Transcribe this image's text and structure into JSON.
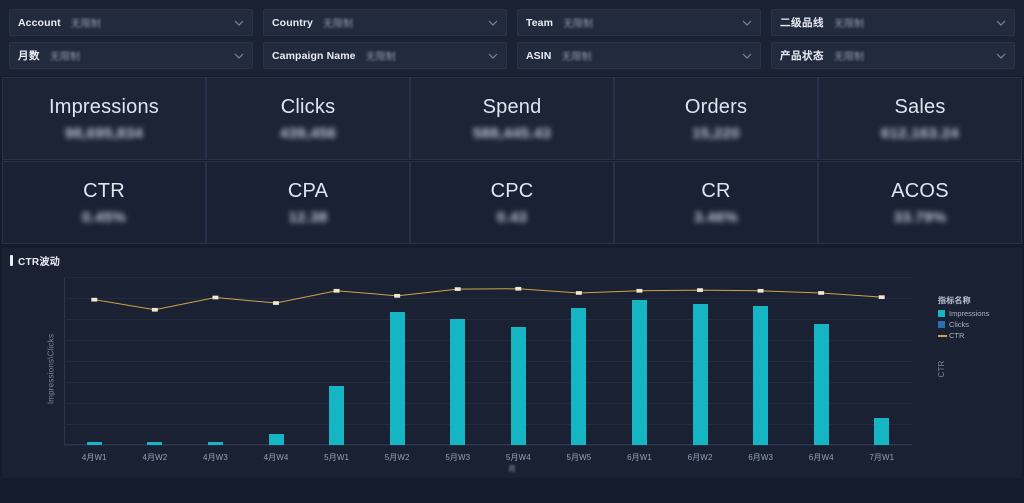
{
  "colors": {
    "page_bg": "#151c2c",
    "panel_bg": "#1a2133",
    "card_bg": "#1c2436",
    "bar_teal": "#15b5c4",
    "legend_clicks_blue": "#2a6fb5",
    "line_orange": "#d2a24f",
    "text_primary": "#e9edf5",
    "text_muted": "#8e98ad"
  },
  "filters": {
    "placeholder": "无限制",
    "items": [
      {
        "label": "Account",
        "value": "无限制",
        "cn": false
      },
      {
        "label": "Country",
        "value": "无限制",
        "cn": false
      },
      {
        "label": "Team",
        "value": "无限制",
        "cn": false
      },
      {
        "label": "二级品线",
        "value": "无限制",
        "cn": true
      },
      {
        "label": "月数",
        "value": "无限制",
        "cn": true
      },
      {
        "label": "Campaign Name",
        "value": "无限制",
        "cn": false
      },
      {
        "label": "ASIN",
        "value": "无限制",
        "cn": false
      },
      {
        "label": "产品状态",
        "value": "无限制",
        "cn": true
      }
    ]
  },
  "metrics": {
    "row1": [
      {
        "title": "Impressions",
        "value": "98,695,834"
      },
      {
        "title": "Clicks",
        "value": "439,456"
      },
      {
        "title": "Spend",
        "value": "588,445.43"
      },
      {
        "title": "Orders",
        "value": "15,220"
      },
      {
        "title": "Sales",
        "value": "612,163.24"
      }
    ],
    "row2": [
      {
        "title": "CTR",
        "value": "0.45%"
      },
      {
        "title": "CPA",
        "value": "12.38"
      },
      {
        "title": "CPC",
        "value": "0.43"
      },
      {
        "title": "CR",
        "value": "3.46%"
      },
      {
        "title": "ACOS",
        "value": "33.79%"
      }
    ]
  },
  "chart_panel": {
    "title": "CTR波动"
  },
  "legend": {
    "title": "指标名称",
    "items": [
      {
        "label": "Impressions",
        "type": "swatch",
        "color": "#15b5c4"
      },
      {
        "label": "Clicks",
        "type": "swatch",
        "color": "#2a6fb5"
      },
      {
        "label": "CTR",
        "type": "line",
        "color": "#d2a24f"
      }
    ]
  },
  "chart_data": {
    "type": "bar",
    "title": "CTR波动",
    "xlabel": "周",
    "ylabel": "Impressions\\Clicks",
    "y2label": "CTR",
    "grid": true,
    "legend_position": "right",
    "categories": [
      "4月W1",
      "4月W2",
      "4月W3",
      "4月W4",
      "5月W1",
      "5月W2",
      "5月W3",
      "5月W4",
      "5月W5",
      "6月W1",
      "6月W2",
      "6月W3",
      "6月W4",
      "7月W1"
    ],
    "ylim": [
      0,
      100
    ],
    "y2lim": [
      0,
      1
    ],
    "series": [
      {
        "name": "Impressions",
        "kind": "bar",
        "axis": "left",
        "color": "#15b5c4",
        "values": [
          1.5,
          2.0,
          1.5,
          6.5,
          35.0,
          79.0,
          75.0,
          70.5,
          81.5,
          86.5,
          84.0,
          83.0,
          72.0,
          16.0
        ]
      },
      {
        "name": "CTR",
        "kind": "line",
        "axis": "right",
        "color": "#d2a24f",
        "values": [
          0.865,
          0.805,
          0.878,
          0.845,
          0.918,
          0.888,
          0.928,
          0.93,
          0.905,
          0.918,
          0.922,
          0.918,
          0.905,
          0.88
        ]
      }
    ]
  }
}
